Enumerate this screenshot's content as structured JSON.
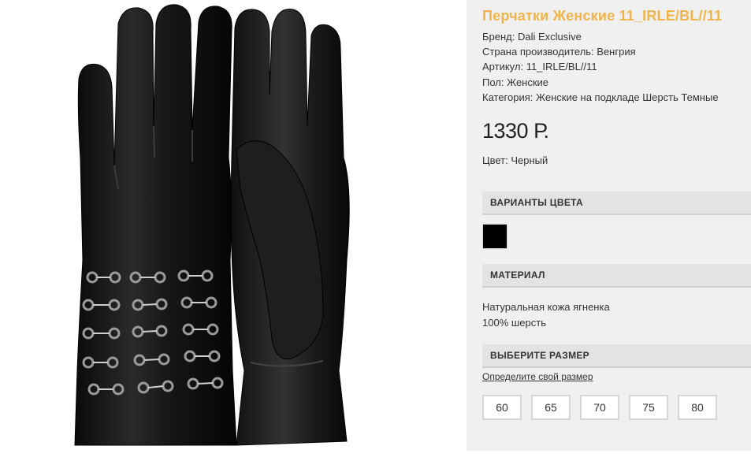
{
  "product": {
    "title": "Перчатки Женские 11_IRLE/BL//11",
    "props": [
      "Бренд: Dali Exclusive",
      "Страна производитель: Венгрия",
      "Артикул: 11_IRLE/BL//11",
      "Пол: Женские",
      "Категория: Женские на подкладе Шерсть Темные"
    ],
    "price": "1330 Р.",
    "color": "Цвет: Черный"
  },
  "sections": {
    "color_variants": "ВАРИАНТЫ ЦВЕТА",
    "material": "МАТЕРИАЛ",
    "size": "ВЫБЕРИТЕ РАЗМЕР"
  },
  "color_swatches": [
    {
      "name": "black",
      "hex": "#000000"
    }
  ],
  "material_lines": [
    "Натуральная кожа ягненка",
    "100% шерсть"
  ],
  "size_link": "Определите свой размер",
  "sizes": [
    "60",
    "65",
    "70",
    "75",
    "80"
  ],
  "colors": {
    "title_accent": "#f0b44a",
    "panel_bg": "#f0f0f0",
    "header_bg": "#e3e3e3"
  },
  "image": {
    "subject": "black-leather-gloves-pair"
  }
}
